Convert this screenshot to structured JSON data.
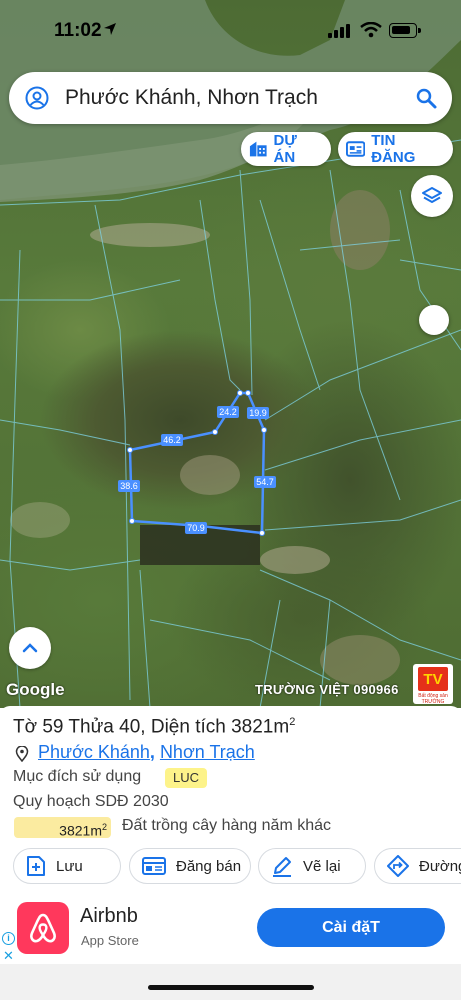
{
  "status_bar": {
    "time": "11:02"
  },
  "search": {
    "query": "Phước Khánh, Nhơn Trạch"
  },
  "map_chips": {
    "du_an": "DỰ ÁN",
    "tin_dang": "TIN ĐĂNG"
  },
  "map": {
    "google_label": "Google",
    "watermark": "TRƯỜNG VIỆT 090966",
    "logo_mark": "TV",
    "logo_caption": "Bất động sản TRƯỜNG",
    "edge_labels": [
      "24.2",
      "19.9",
      "46.2",
      "38.6",
      "54.7",
      "70.9"
    ]
  },
  "parcel": {
    "title": "Tờ 59 Thửa 40, Diện tích 3821m",
    "title_sup": "2",
    "ward": "Phước Khánh",
    "district": "Nhơn Trạch",
    "purpose_label": "Mục đích sử dụng",
    "purpose_code": "LUC",
    "plan_label": "Quy hoạch SDĐ 2030",
    "area_value": "3821m",
    "area_sup": "2",
    "land_type": "Đất trồng cây hàng năm khác"
  },
  "actions": {
    "save": "Lưu",
    "post": "Đăng bán",
    "redraw": "Vẽ lại",
    "route": "Đường"
  },
  "ad": {
    "app_name": "Airbnb",
    "store": "App Store",
    "install": "Cài đặT"
  },
  "colors": {
    "accent": "#1a73e8",
    "parcel_line": "#4a90ff",
    "ad_brand": "#ff385c"
  }
}
